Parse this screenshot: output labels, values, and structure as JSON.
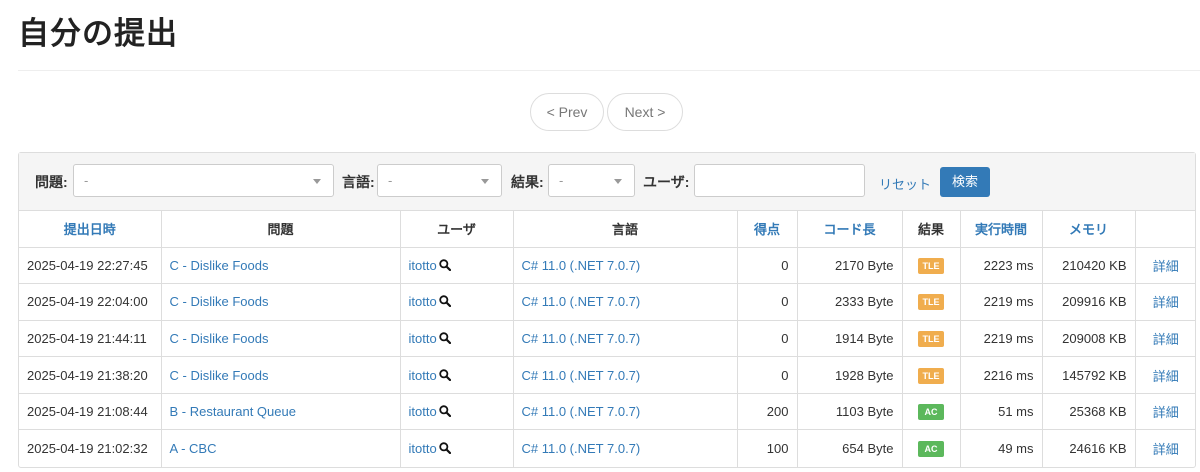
{
  "page": {
    "title": "自分の提出"
  },
  "pager": {
    "prev": "< Prev",
    "next": "Next >"
  },
  "filters": {
    "problem_label": "問題:",
    "problem_value": "-",
    "language_label": "言語:",
    "language_value": "-",
    "result_label": "結果:",
    "result_value": "-",
    "user_label": "ユーザ:",
    "user_value": "",
    "reset": "リセット",
    "search": "検索"
  },
  "table": {
    "headers": [
      "提出日時",
      "問題",
      "ユーザ",
      "言語",
      "得点",
      "コード長",
      "結果",
      "実行時間",
      "メモリ",
      ""
    ],
    "rows": [
      {
        "date": "2025-04-19 22:27:45",
        "problem": "C - Dislike Foods",
        "user": "itotto",
        "language": "C# 11.0 (.NET 7.0.7)",
        "score": "0",
        "code_length": "2170 Byte",
        "result": "TLE",
        "time": "2223 ms",
        "memory": "210420 KB",
        "detail": "詳細"
      },
      {
        "date": "2025-04-19 22:04:00",
        "problem": "C - Dislike Foods",
        "user": "itotto",
        "language": "C# 11.0 (.NET 7.0.7)",
        "score": "0",
        "code_length": "2333 Byte",
        "result": "TLE",
        "time": "2219 ms",
        "memory": "209916 KB",
        "detail": "詳細"
      },
      {
        "date": "2025-04-19 21:44:11",
        "problem": "C - Dislike Foods",
        "user": "itotto",
        "language": "C# 11.0 (.NET 7.0.7)",
        "score": "0",
        "code_length": "1914 Byte",
        "result": "TLE",
        "time": "2219 ms",
        "memory": "209008 KB",
        "detail": "詳細"
      },
      {
        "date": "2025-04-19 21:38:20",
        "problem": "C - Dislike Foods",
        "user": "itotto",
        "language": "C# 11.0 (.NET 7.0.7)",
        "score": "0",
        "code_length": "1928 Byte",
        "result": "TLE",
        "time": "2216 ms",
        "memory": "145792 KB",
        "detail": "詳細"
      },
      {
        "date": "2025-04-19 21:08:44",
        "problem": "B - Restaurant Queue",
        "user": "itotto",
        "language": "C# 11.0 (.NET 7.0.7)",
        "score": "200",
        "code_length": "1103 Byte",
        "result": "AC",
        "time": "51 ms",
        "memory": "25368 KB",
        "detail": "詳細"
      },
      {
        "date": "2025-04-19 21:02:32",
        "problem": "A - CBC",
        "user": "itotto",
        "language": "C# 11.0 (.NET 7.0.7)",
        "score": "100",
        "code_length": "654 Byte",
        "result": "AC",
        "time": "49 ms",
        "memory": "24616 KB",
        "detail": "詳細"
      }
    ]
  },
  "colors": {
    "link": "#337ab7",
    "tle": "#f0ad4e",
    "ac": "#5cb85c",
    "primary": "#337ab7"
  }
}
